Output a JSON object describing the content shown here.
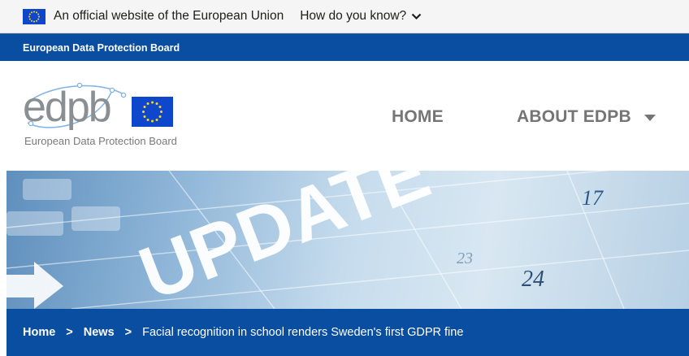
{
  "eu_banner": {
    "text": "An official website of the European Union",
    "link": "How do you know?"
  },
  "top_strip": {
    "label": "European Data Protection Board"
  },
  "logo": {
    "text": "edpb",
    "subtitle": "European Data Protection Board"
  },
  "nav": {
    "home": "HOME",
    "about": "ABOUT EDPB"
  },
  "hero": {
    "word": "UPDATE",
    "numbers": [
      "17",
      "23",
      "24"
    ]
  },
  "breadcrumb": {
    "home": "Home",
    "news": "News",
    "current": "Facial recognition in school renders Sweden's first GDPR fine",
    "separator": ">"
  },
  "colors": {
    "eu_blue": "#0e47cb",
    "eu_yellow": "#ffd617",
    "strip_blue": "#0a4ea2",
    "nav_gray": "#757575"
  },
  "icons": [
    "eu-flag-icon",
    "chevron-down-icon",
    "caret-down-icon",
    "chevron-right-icon"
  ]
}
